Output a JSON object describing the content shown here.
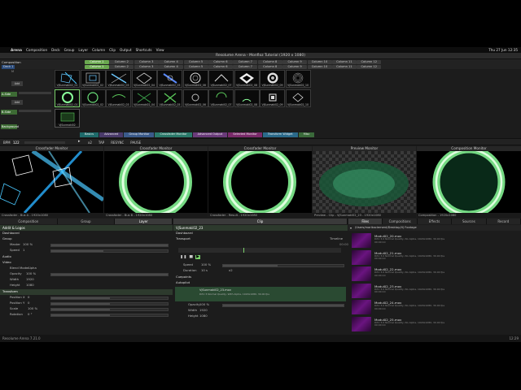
{
  "menubar": {
    "items": [
      "Arena",
      "Composition",
      "Deck",
      "Group",
      "Layer",
      "Column",
      "Clip",
      "Output",
      "Shortcuts",
      "View"
    ],
    "clock": "Thu 27 Jun 12:35"
  },
  "window": {
    "title": "Resolume Arena - Monfloz Tutorial (1920 x 1080)"
  },
  "left": {
    "composition_label": "Composition",
    "deck_label": "Deck 1",
    "add_label": "Add",
    "layers": [
      {
        "label": "A-Side",
        "color": "#6aa84f"
      },
      {
        "label": "B-Side",
        "color": "#6aa84f"
      },
      {
        "label": "Background",
        "color": "#6aa84f"
      }
    ]
  },
  "columns": {
    "row1": [
      "Column 1",
      "Column 2",
      "Column 3",
      "Column 4",
      "Column 5",
      "Column 6",
      "Column 7",
      "Column 8",
      "Column 9",
      "Column 10",
      "Column 11",
      "Column 12"
    ],
    "row2": [
      "Column 1",
      "Column 2",
      "Column 3",
      "Column 4",
      "Column 5",
      "Column 6",
      "Column 7",
      "Column 8",
      "Column 9",
      "Column 10",
      "Column 11",
      "Column 12"
    ]
  },
  "clips": {
    "row1": [
      "VjSunmaki02_01",
      "VjSunmaki02_02",
      "VjSunmaki02_03",
      "VjSunmaki02_04",
      "VjSunmaki02_05",
      "VjSunmaki02_06",
      "VjSunmaki02_07",
      "VjSunmaki02_08",
      "VjSunmaki02_09",
      "VjSunmaki02_10"
    ],
    "row2": [
      "VjSunmaki02_01",
      "VjSunmaki02_02",
      "VjSunmaki02_03",
      "VjSunmaki02_04",
      "VjSunmaki02_05",
      "VjSunmaki02_06",
      "VjSunmaki02_07",
      "VjSunmaki02_08",
      "VjSunmaki02_09",
      "VjSunmaki02_10"
    ],
    "row3": [
      "VjSunmaki02"
    ]
  },
  "tabs": [
    {
      "label": "Basics",
      "color": "#1e6a6a"
    },
    {
      "label": "Advanced",
      "color": "#4a3a6a"
    },
    {
      "label": "Group Monitor",
      "color": "#3a5a8a"
    },
    {
      "label": "Crossfader Monitor",
      "color": "#2a7a6a"
    },
    {
      "label": "Advanced Output",
      "color": "#6a3a7a"
    },
    {
      "label": "Selected Monitor",
      "color": "#7a2a6a"
    },
    {
      "label": "Transform Widget",
      "color": "#2a6a8a"
    },
    {
      "label": "Misc",
      "color": "#3a6a3a"
    }
  ],
  "transport": {
    "bpm_label": "BPM",
    "bpm": "122",
    "controls": [
      "x2",
      "TAP",
      "RESYNC",
      "PAUSE"
    ]
  },
  "monitors": [
    {
      "header": "Crossfader Monitor",
      "footer": "Crossfader - Bus A - 1920x1080"
    },
    {
      "header": "Crossfader Monitor",
      "footer": "Crossfader - Bus B - 1920x1080"
    },
    {
      "header": "Crossfader Monitor",
      "footer": "Crossfader - Result - 1920x1080"
    },
    {
      "header": "Preview Monitor",
      "footer": "Preview - Clip - VjSunmaki02_23 - 1920x1080"
    },
    {
      "header": "Composition Monitor",
      "footer": "Composition - 1920x1080"
    }
  ],
  "left_panel": {
    "tabs": [
      "Composition",
      "Group",
      "Layer"
    ],
    "title": "Addit & Logos",
    "sections": {
      "dashboard": "Dashboard",
      "group": "Group",
      "master": "Master",
      "master_val": "100 %",
      "speed": "Speed",
      "speed_val": "1",
      "audio": "Audio",
      "video": "Video",
      "blend_mode": "Blend Mode",
      "blend_val": "Alpha",
      "opacity": "Opacity",
      "opacity_val": "100 %",
      "width": "Width",
      "width_val": "1920",
      "height": "Height",
      "height_val": "1080",
      "transform": "Transform",
      "pos_x": "Position X",
      "pos_x_val": "0",
      "pos_y": "Position Y",
      "pos_y_val": "0",
      "scale": "Scale",
      "scale_val": "100 %",
      "rotation": "Rotation",
      "rotation_val": "0 °"
    }
  },
  "clip_panel": {
    "tab": "Clip",
    "title": "VjSunmaki02_23",
    "dashboard": "Dashboard",
    "transport": "Transport",
    "timeline": "Timeline",
    "time": "00:00",
    "speed": "Speed",
    "speed_val": "100 %",
    "duration": "Duration",
    "duration_val": "10 s",
    "x2": "x2",
    "cuepoints": "Cuepoints",
    "autopilot": "Autopilot",
    "file_name": "VjSunmaki02_23.mov",
    "file_desc": "DXV 3 Normal Quality, With Alpha, 1920x1080, 30.00 fps",
    "opacity": "Opacity",
    "opacity_val": "100 %",
    "width": "Width",
    "width_val": "1920",
    "height": "Height",
    "height_val": "1080"
  },
  "files_panel": {
    "tabs": [
      "Files",
      "Compositions",
      "Effects",
      "Sources",
      "Record"
    ],
    "path": "/Users/marikaclement/Desktop/Vj Footage",
    "items": [
      {
        "name": "Modul02_20.mov",
        "desc": "DXV 3.0 Normal Quality, No Alpha, 1920x1080, 30.00 fps",
        "time": "00:00:10"
      },
      {
        "name": "Modul02_21.mov",
        "desc": "DXV 3.0 Normal Quality, No Alpha, 1920x1080, 30.00 fps",
        "time": "00:00:10"
      },
      {
        "name": "Modul02_22.mov",
        "desc": "DXV 3.0 Normal Quality, No Alpha, 1920x1080, 30.00 fps",
        "time": "00:00:10"
      },
      {
        "name": "Modul02_23.mov",
        "desc": "DXV 3.0 Normal Quality, No Alpha, 1920x1080, 30.00 fps",
        "time": "00:00:10"
      },
      {
        "name": "Modul02_24.mov",
        "desc": "DXV 3.0 Normal Quality, No Alpha, 1920x1080, 30.00 fps",
        "time": "00:00:10"
      },
      {
        "name": "Modul02_25.mov",
        "desc": "DXV 3.0 Normal Quality, No Alpha, 1920x1080, 30.00 fps",
        "time": "00:00:10"
      }
    ]
  },
  "status": {
    "version": "Resolume Arena 7.21.0",
    "time": "12:29"
  }
}
